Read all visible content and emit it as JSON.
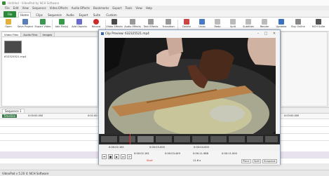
{
  "window": {
    "title": "Untitled - VideoPad by NCH Software"
  },
  "menu": [
    "File",
    "Edit",
    "View",
    "Sequence",
    "Video Effects",
    "Audio Effects",
    "Bookmarks",
    "Export",
    "Tools",
    "View",
    "Help"
  ],
  "ribbon": {
    "file": "File",
    "tabs": [
      "Home",
      "Clips",
      "Sequence",
      "Audio",
      "Export",
      "Suite",
      "Custom"
    ]
  },
  "toolbar": [
    {
      "label": "Open",
      "icon": "folder-icon",
      "color": "#e2b13c"
    },
    {
      "label": "Save Project",
      "icon": "save-icon",
      "color": "#5a7fb5"
    },
    {
      "label": "Export Video",
      "icon": "export-icon",
      "color": "#3c9a50"
    },
    {
      "label": "Add File(s)",
      "icon": "add-file-icon",
      "color": "#3a9a4a"
    },
    {
      "label": "Add Objects",
      "icon": "add-objects-icon",
      "color": "#6a6ad0"
    },
    {
      "label": "Record",
      "icon": "record-icon",
      "color": "#cc2b2b"
    },
    {
      "label": "Video Effects",
      "icon": "video-effects-icon",
      "color": "#4a4a4a"
    },
    {
      "label": "Audio Effects",
      "icon": "audio-effects-icon",
      "color": "#777"
    },
    {
      "label": "Text Effects",
      "icon": "text-effects-icon",
      "color": "#777"
    },
    {
      "label": "Transition",
      "icon": "transition-icon",
      "color": "#777"
    },
    {
      "label": "Delete",
      "icon": "delete-icon",
      "color": "#c44"
    },
    {
      "label": "Undo",
      "icon": "undo-icon",
      "color": "#4a7ac0"
    },
    {
      "label": "Redo",
      "icon": "redo-icon",
      "color": "#aaa"
    },
    {
      "label": "Split",
      "icon": "split-icon",
      "color": "#aaa"
    },
    {
      "label": "Subtitles",
      "icon": "subtitles-icon",
      "color": "#aaa"
    },
    {
      "label": "Render",
      "icon": "render-icon",
      "color": "#aaa"
    },
    {
      "label": "Updates",
      "icon": "updates-icon",
      "color": "#3c70c0"
    },
    {
      "label": "Buy Online",
      "icon": "cart-icon",
      "color": "#777"
    },
    {
      "label": "NCH Suite",
      "icon": "nch-suite-icon",
      "color": "#555"
    }
  ],
  "clips_panel": {
    "tabs": [
      "Video Files",
      "Audio Files",
      "Images"
    ],
    "clip_label": "632325521.mp4"
  },
  "clip_preview": {
    "title": "Clip Preview: 632325521.mp4",
    "ruler": [
      "0:00:02.161",
      "0:00:03.000",
      "0:00:04.000"
    ],
    "start_time": "0:00:02.161",
    "mark_in": "0:00:03.449",
    "mark_out": "0:00:11.988",
    "duration": "0:00:11.000",
    "start_label": "Start",
    "range": "11.6 x",
    "buttons": [
      "Place",
      "Split",
      "Snapshot"
    ]
  },
  "sequence": {
    "tab": "Sequence 1",
    "timeline_label": "Timeline",
    "ruler": [
      "0:00:00.000",
      "0:01:00.000",
      "0:02:00.000",
      "0:03:00.000"
    ]
  },
  "status": "VideoPad v 5.20 © NCH Software"
}
